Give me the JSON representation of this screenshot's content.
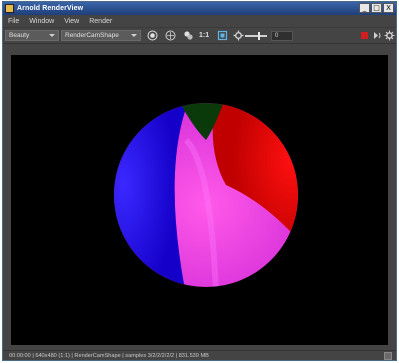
{
  "window": {
    "title": "Arnold RenderView"
  },
  "window_buttons": {
    "minimize": "_",
    "maximize": "□",
    "close": "X"
  },
  "menu": [
    "File",
    "Window",
    "View",
    "Render"
  ],
  "toolbar": {
    "aov_selected": "Beauty",
    "camera_selected": "RenderCamShape",
    "ratio_label": "1:1",
    "exposure_value": "0",
    "accent_stop": "#d21e1e"
  },
  "status": {
    "text": "00:00:00 | 640x480 (1:1) | RenderCamShape | samples 3/2/2/2/2/2 | 831.539 MB"
  }
}
